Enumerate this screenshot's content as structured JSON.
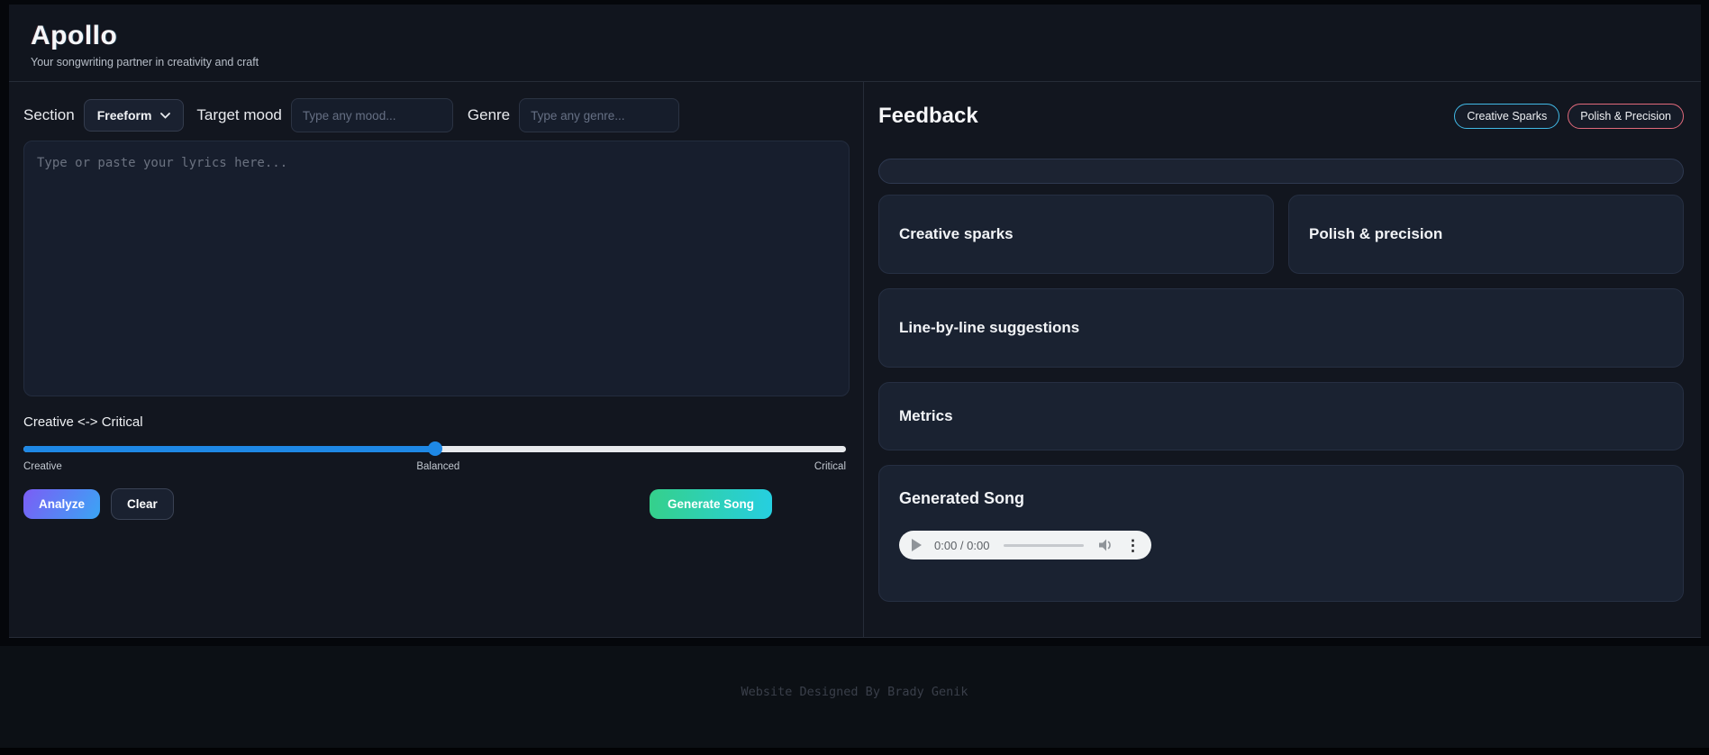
{
  "header": {
    "title": "Apollo",
    "subtitle": "Your songwriting partner in creativity and craft"
  },
  "composer": {
    "section_label": "Section",
    "section_value": "Freeform",
    "mood_label": "Target mood",
    "mood_placeholder": "Type any mood...",
    "genre_label": "Genre",
    "genre_placeholder": "Type any genre...",
    "lyrics_placeholder": "Type or paste your lyrics here...",
    "slider": {
      "label": "Creative <-> Critical",
      "left_label": "Creative",
      "center_label": "Balanced",
      "right_label": "Critical",
      "value_percent": 50,
      "fill_color": "#1e88e5",
      "track_color": "#e8eaed"
    },
    "buttons": {
      "analyze": "Analyze",
      "clear": "Clear",
      "generate": "Generate Song"
    }
  },
  "feedback": {
    "title": "Feedback",
    "pills": [
      {
        "label": "Creative Sparks",
        "border_color": "#41b9e6"
      },
      {
        "label": "Polish & Precision",
        "border_color": "#e0697a"
      }
    ],
    "cards": [
      {
        "title": "Creative sparks"
      },
      {
        "title": "Polish & precision"
      },
      {
        "title": "Line-by-line suggestions"
      },
      {
        "title": "Metrics"
      },
      {
        "title": "Generated Song"
      }
    ],
    "audio": {
      "time": "0:00 / 0:00"
    }
  },
  "footer": {
    "credit": "Website Designed By Brady Genik"
  },
  "colors": {
    "app_bg": "#12161f",
    "card_bg": "#1a2231",
    "accent_blue": "#1e88e5",
    "analyze_gradient": [
      "#7b5df5",
      "#3aa5f5"
    ],
    "generate_gradient": [
      "#35d08b",
      "#26cfe0"
    ],
    "pill_cyan": "#41b9e6",
    "pill_red": "#e0697a"
  }
}
